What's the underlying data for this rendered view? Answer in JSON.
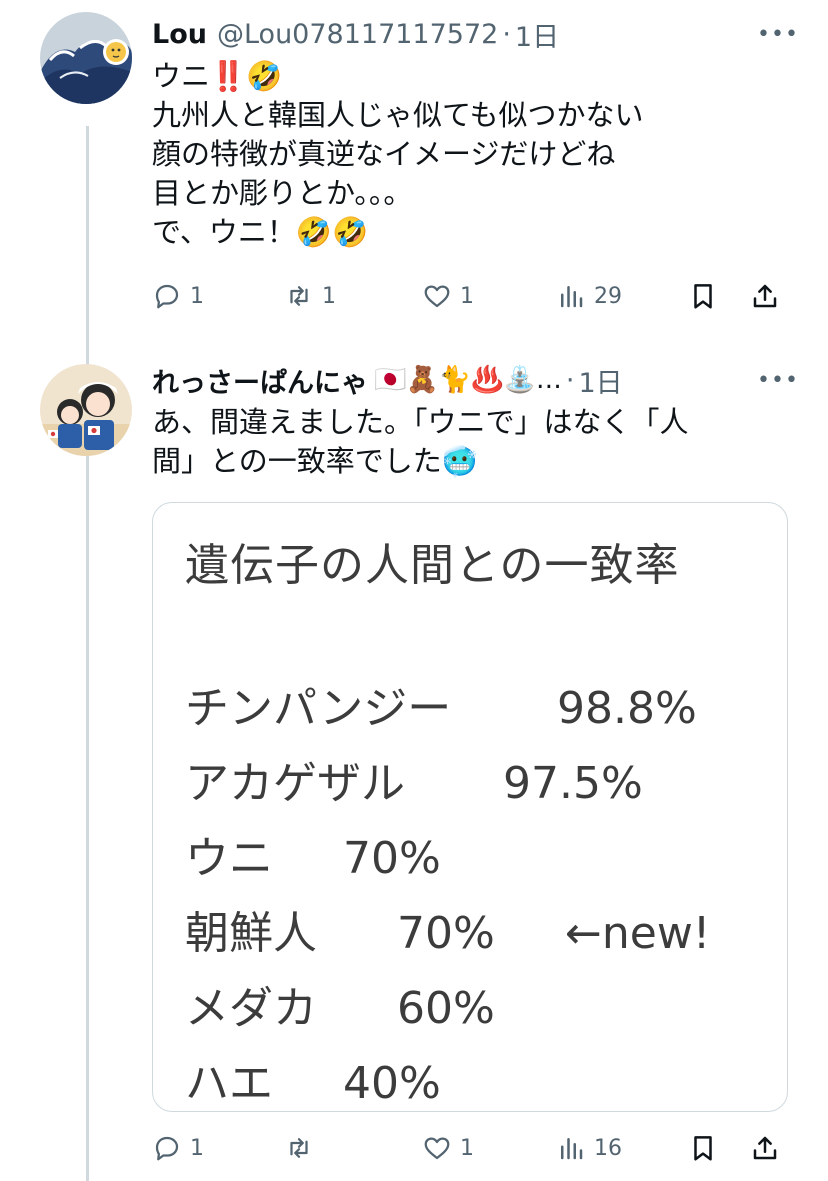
{
  "posts": [
    {
      "author_name": "Lou",
      "author_handle": "@Lou078117117572",
      "time": "1日",
      "text_lines": [
        "ウニ‼️🤣",
        "九州人と韓国人じゃ似ても似つかない",
        "顔の特徴が真逆なイメージだけどね",
        "目とか彫りとか。。。",
        "で、ウニ！🤣🤣"
      ],
      "actions": {
        "replies": "1",
        "reposts": "1",
        "likes": "1",
        "views": "29"
      }
    },
    {
      "author_name": "れっさーぱんにゃ",
      "author_name_suffix": "🇯🇵🧸🐈♨️⛲…",
      "time": "1日",
      "text_lines": [
        "あ、間違えました。「ウニで」はなく「人",
        "間」との一致率でした🥶"
      ],
      "media": {
        "title": "遺伝子の人間との一致率",
        "rows": [
          {
            "label": "チンパンジー",
            "value": "98.8%"
          },
          {
            "label": "アカゲザル",
            "value": "97.5%"
          },
          {
            "label": "ウニ",
            "value": "70%"
          },
          {
            "label": "朝鮮人",
            "value": "70%",
            "note": "←new!"
          },
          {
            "label": "メダカ",
            "value": "60%"
          },
          {
            "label": "ハエ",
            "value": "40%"
          }
        ]
      },
      "actions": {
        "replies": "1",
        "reposts": "",
        "likes": "1",
        "views": "16"
      }
    }
  ],
  "icons": {
    "reply": "speech-bubble-icon",
    "repost": "repost-arrows-icon",
    "like": "heart-icon",
    "views": "bar-chart-icon",
    "bookmark": "bookmark-icon",
    "share": "share-upload-icon",
    "more": "more-dots-icon"
  },
  "colors": {
    "muted": "#536471",
    "divider": "#cfd9de",
    "text": "#0f1419"
  }
}
